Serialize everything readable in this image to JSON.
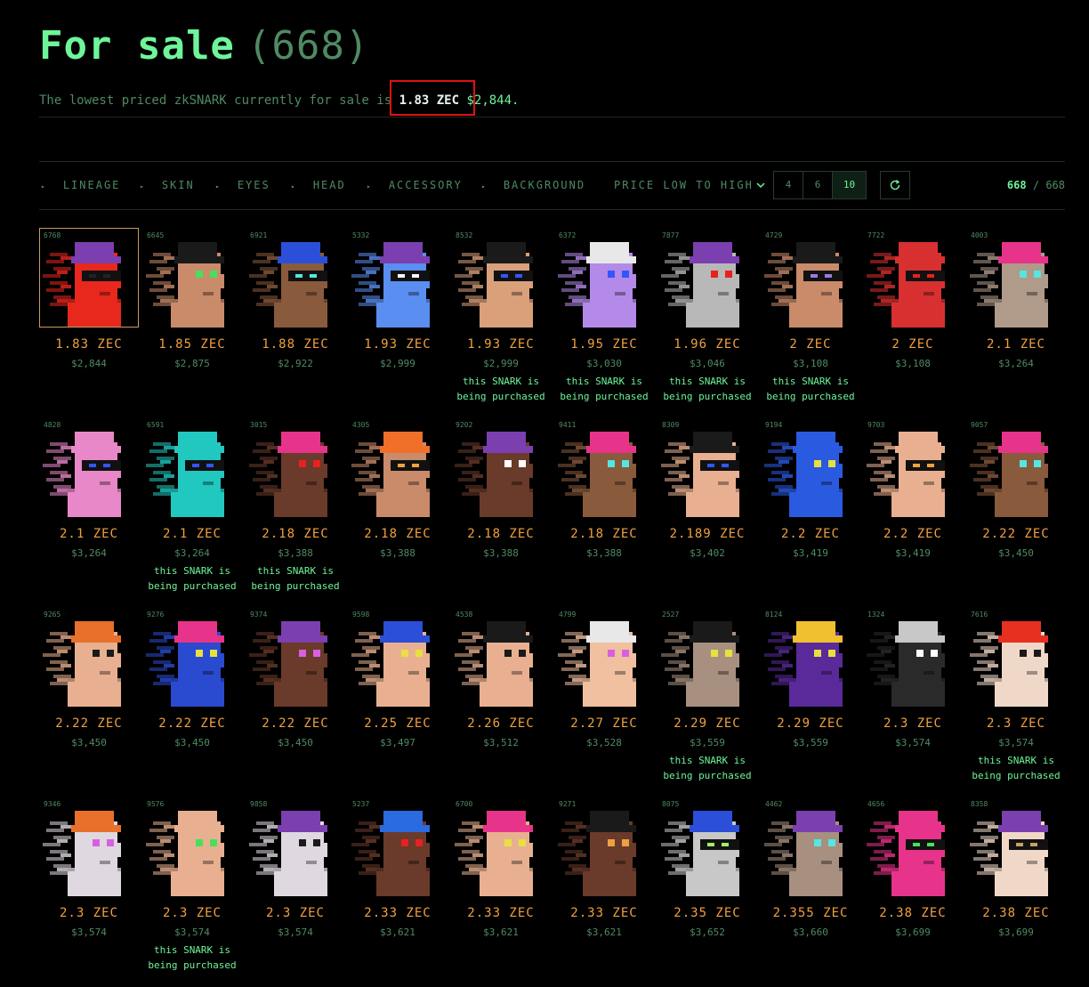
{
  "header": {
    "title": "For sale",
    "count": "(668)",
    "subtitle_prefix": "The lowest priced zkSNARK currently for sale is",
    "lowest_zec": "1.83 ZEC",
    "lowest_usd": "$2,844."
  },
  "filters": [
    {
      "label": "LINEAGE"
    },
    {
      "label": "SKIN"
    },
    {
      "label": "EYES"
    },
    {
      "label": "HEAD"
    },
    {
      "label": "ACCESSORY"
    },
    {
      "label": "BACKGROUND"
    }
  ],
  "sort_label": "PRICE LOW TO HIGH",
  "columns_options": [
    "4",
    "6",
    "10"
  ],
  "columns_selected": "10",
  "counter": {
    "current": "668",
    "separator": "/",
    "total": "668"
  },
  "purchasing_label_1": "this SNARK is",
  "purchasing_label_2": "being purchased",
  "items": [
    {
      "id": "6768",
      "price": "1.83 ZEC",
      "usd": "$2,844",
      "purchasing": false,
      "skin": "#e8271d",
      "hat": "#7b3fb0",
      "eye": "#222",
      "visor": true,
      "selected": true
    },
    {
      "id": "6645",
      "price": "1.85 ZEC",
      "usd": "$2,875",
      "purchasing": false,
      "skin": "#c98b6a",
      "hat": "#1a1a1a",
      "eye": "#47e05a"
    },
    {
      "id": "6921",
      "price": "1.88 ZEC",
      "usd": "$2,922",
      "purchasing": false,
      "skin": "#8a5a3c",
      "hat": "#2b4fd8",
      "eye": "#55e6e0",
      "visor": true
    },
    {
      "id": "5332",
      "price": "1.93 ZEC",
      "usd": "$2,999",
      "purchasing": false,
      "skin": "#5a8ef0",
      "hat": "#7b3fb0",
      "eye": "#ffffff",
      "visor": true
    },
    {
      "id": "8532",
      "price": "1.93 ZEC",
      "usd": "$2,999",
      "purchasing": true,
      "skin": "#d9a07a",
      "hat": "#1a1a1a",
      "eye": "#3355ff",
      "visor": true
    },
    {
      "id": "6372",
      "price": "1.95 ZEC",
      "usd": "$3,030",
      "purchasing": true,
      "skin": "#b48ae8",
      "hat": "#e8e8e8",
      "eye": "#3355ff"
    },
    {
      "id": "7877",
      "price": "1.96 ZEC",
      "usd": "$3,046",
      "purchasing": true,
      "skin": "#b8b8b8",
      "hat": "#7b3fb0",
      "eye": "#e82020"
    },
    {
      "id": "4729",
      "price": "2 ZEC",
      "usd": "$3,108",
      "purchasing": true,
      "skin": "#c98b6a",
      "hat": "#1a1a1a",
      "eye": "#9a7ae0",
      "visor": true
    },
    {
      "id": "7722",
      "price": "2 ZEC",
      "usd": "$3,108",
      "purchasing": false,
      "skin": "#d83030",
      "hat": "#d83030",
      "eye": "#e82020",
      "visor": true
    },
    {
      "id": "4003",
      "price": "2.1 ZEC",
      "usd": "$3,264",
      "purchasing": false,
      "skin": "#b09a8a",
      "hat": "#e8338a",
      "eye": "#55e6e0"
    },
    {
      "id": "4828",
      "price": "2.1 ZEC",
      "usd": "$3,264",
      "purchasing": false,
      "skin": "#e888c8",
      "hat": "#e888c8",
      "eye": "#3355ff",
      "visor": true
    },
    {
      "id": "6591",
      "price": "2.1 ZEC",
      "usd": "$3,264",
      "purchasing": true,
      "skin": "#20c8c0",
      "hat": "#20c8c0",
      "eye": "#3355ff",
      "visor": true
    },
    {
      "id": "3015",
      "price": "2.18 ZEC",
      "usd": "$3,388",
      "purchasing": true,
      "skin": "#6a3a2a",
      "hat": "#e8338a",
      "eye": "#e82020"
    },
    {
      "id": "4305",
      "price": "2.18 ZEC",
      "usd": "$3,388",
      "purchasing": false,
      "skin": "#c98b6a",
      "hat": "#f0702a",
      "eye": "#f0a040",
      "visor": true
    },
    {
      "id": "9202",
      "price": "2.18 ZEC",
      "usd": "$3,388",
      "purchasing": false,
      "skin": "#6a3a2a",
      "hat": "#7b3fb0",
      "eye": "#ffffff"
    },
    {
      "id": "9411",
      "price": "2.18 ZEC",
      "usd": "$3,388",
      "purchasing": false,
      "skin": "#8a5a3c",
      "hat": "#e8338a",
      "eye": "#55e6e0"
    },
    {
      "id": "8309",
      "price": "2.189 ZEC",
      "usd": "$3,402",
      "purchasing": false,
      "skin": "#e8b090",
      "hat": "#1a1a1a",
      "eye": "#3355ff",
      "visor": true
    },
    {
      "id": "9194",
      "price": "2.2 ZEC",
      "usd": "$3,419",
      "purchasing": false,
      "skin": "#2a5ae0",
      "hat": "#2a5ae0",
      "eye": "#e8e040"
    },
    {
      "id": "9703",
      "price": "2.2 ZEC",
      "usd": "$3,419",
      "purchasing": false,
      "skin": "#e8b090",
      "hat": "#e8b090",
      "eye": "#f0a040",
      "visor": true
    },
    {
      "id": "9057",
      "price": "2.22 ZEC",
      "usd": "$3,450",
      "purchasing": false,
      "skin": "#8a5a3c",
      "hat": "#e8338a",
      "eye": "#55e6e0"
    },
    {
      "id": "9265",
      "price": "2.22 ZEC",
      "usd": "$3,450",
      "purchasing": false,
      "skin": "#e8b090",
      "hat": "#e8702a",
      "eye": "#1a1a1a"
    },
    {
      "id": "9276",
      "price": "2.22 ZEC",
      "usd": "$3,450",
      "purchasing": false,
      "skin": "#2a4ad0",
      "hat": "#e8338a",
      "eye": "#e8e040"
    },
    {
      "id": "9374",
      "price": "2.22 ZEC",
      "usd": "$3,450",
      "purchasing": false,
      "skin": "#6a3a2a",
      "hat": "#7b3fb0",
      "eye": "#d860e0"
    },
    {
      "id": "9598",
      "price": "2.25 ZEC",
      "usd": "$3,497",
      "purchasing": false,
      "skin": "#e8b090",
      "hat": "#2b4fd8",
      "eye": "#e8e040"
    },
    {
      "id": "4538",
      "price": "2.26 ZEC",
      "usd": "$3,512",
      "purchasing": false,
      "skin": "#e8b090",
      "hat": "#1a1a1a",
      "eye": "#1a1a1a"
    },
    {
      "id": "4799",
      "price": "2.27 ZEC",
      "usd": "$3,528",
      "purchasing": false,
      "skin": "#f0c0a0",
      "hat": "#e8e8e8",
      "eye": "#d860e0"
    },
    {
      "id": "2527",
      "price": "2.29 ZEC",
      "usd": "$3,559",
      "purchasing": true,
      "skin": "#a89080",
      "hat": "#1a1a1a",
      "eye": "#e8e040"
    },
    {
      "id": "8124",
      "price": "2.29 ZEC",
      "usd": "$3,559",
      "purchasing": false,
      "skin": "#5a2a9a",
      "hat": "#f0c030",
      "eye": "#e8e040"
    },
    {
      "id": "1324",
      "price": "2.3 ZEC",
      "usd": "$3,574",
      "purchasing": false,
      "skin": "#2a2a2a",
      "hat": "#c8c8c8",
      "eye": "#ffffff"
    },
    {
      "id": "7616",
      "price": "2.3 ZEC",
      "usd": "$3,574",
      "purchasing": true,
      "skin": "#f0d8c8",
      "hat": "#e83020",
      "eye": "#1a1a1a"
    },
    {
      "id": "9346",
      "price": "2.3 ZEC",
      "usd": "$3,574",
      "purchasing": false,
      "skin": "#e0d8e0",
      "hat": "#e8702a",
      "eye": "#d860e0"
    },
    {
      "id": "9576",
      "price": "2.3 ZEC",
      "usd": "$3,574",
      "purchasing": true,
      "skin": "#e8b090",
      "hat": "#e8b090",
      "eye": "#47e05a"
    },
    {
      "id": "9858",
      "price": "2.3 ZEC",
      "usd": "$3,574",
      "purchasing": false,
      "skin": "#e0d8e0",
      "hat": "#7b3fb0",
      "eye": "#1a1a1a"
    },
    {
      "id": "5237",
      "price": "2.33 ZEC",
      "usd": "$3,621",
      "purchasing": false,
      "skin": "#6a3a2a",
      "hat": "#2b6ae0",
      "eye": "#e82020"
    },
    {
      "id": "6700",
      "price": "2.33 ZEC",
      "usd": "$3,621",
      "purchasing": false,
      "skin": "#e8b090",
      "hat": "#e8338a",
      "eye": "#e8e040"
    },
    {
      "id": "9271",
      "price": "2.33 ZEC",
      "usd": "$3,621",
      "purchasing": false,
      "skin": "#6a3a2a",
      "hat": "#1a1a1a",
      "eye": "#f0a040"
    },
    {
      "id": "8075",
      "price": "2.35 ZEC",
      "usd": "$3,652",
      "purchasing": false,
      "skin": "#c8c8c8",
      "hat": "#2b4fd8",
      "eye": "#a0f060",
      "visor": true
    },
    {
      "id": "4462",
      "price": "2.355 ZEC",
      "usd": "$3,660",
      "purchasing": false,
      "skin": "#a89080",
      "hat": "#7b3fb0",
      "eye": "#55e6e0"
    },
    {
      "id": "4656",
      "price": "2.38 ZEC",
      "usd": "$3,699",
      "purchasing": false,
      "skin": "#e8338a",
      "hat": "#e8338a",
      "eye": "#47e05a",
      "visor": true
    },
    {
      "id": "8358",
      "price": "2.38 ZEC",
      "usd": "$3,699",
      "purchasing": false,
      "skin": "#f0d8c8",
      "hat": "#7b3fb0",
      "eye": "#c8a060",
      "visor": true
    }
  ],
  "colors": {
    "background": "#000000",
    "accent": "#6ef59a",
    "price": "#f0a040",
    "muted": "#4f8a63",
    "highlight_box": "#e01010"
  }
}
